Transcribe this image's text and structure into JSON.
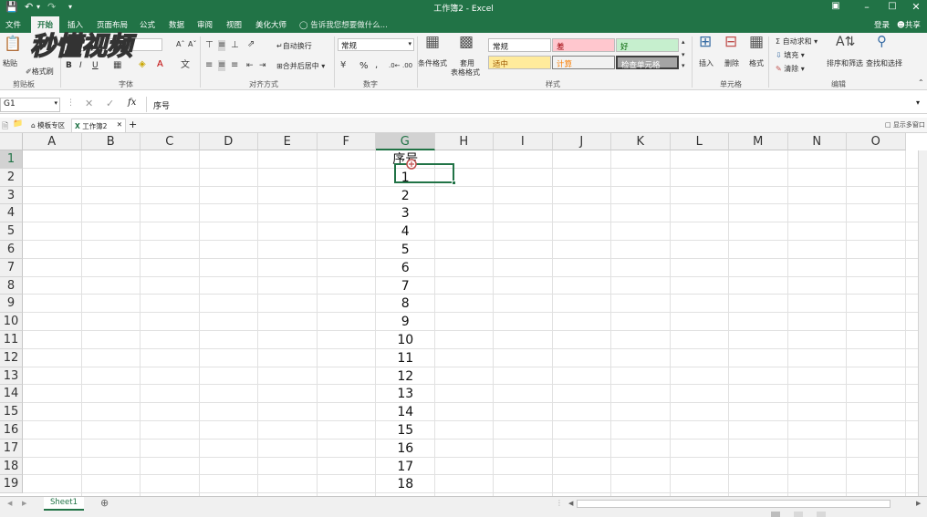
{
  "titlebar": {
    "title": "工作簿2 - Excel",
    "controls": [
      "restore-icon",
      "minimize-icon",
      "maximize-icon",
      "close-icon"
    ]
  },
  "tabs": {
    "file": "文件",
    "home": "开始",
    "insert": "插入",
    "page_layout": "页面布局",
    "formulas": "公式",
    "data": "数据",
    "review": "审阅",
    "view": "视图",
    "beautify": "美化大师",
    "tell_me": "告诉我您想要做什么...",
    "login": "登录",
    "share": "共享"
  },
  "ribbon": {
    "paste": "粘贴",
    "format_painter": "格式刷",
    "clipboard": "剪贴板",
    "bold": "B",
    "italic": "I",
    "underline": "U",
    "font_group": "字体",
    "wrap_text": "自动换行",
    "merge_center": "合并后居中",
    "alignment_group": "对齐方式",
    "number_format": "常规",
    "percent": "%",
    "comma": ",",
    "number_group": "数字",
    "cond_format": "条件格式",
    "table_format_1": "套用",
    "table_format_2": "表格格式",
    "styles": {
      "normal": "常规",
      "bad": "差",
      "good": "好",
      "neutral": "适中",
      "calculation": "计算",
      "check_cell": "检查单元格"
    },
    "styles_group": "样式",
    "insert": "插入",
    "delete": "删除",
    "format": "格式",
    "cells_group": "单元格",
    "autosum": "自动求和",
    "fill": "填充",
    "clear": "清除",
    "sort_filter": "排序和筛选",
    "find_select": "查找和选择",
    "editing_group": "编辑"
  },
  "formula_bar": {
    "name_box": "G1",
    "fx": "fx",
    "content": "序号"
  },
  "workbook_tabs": {
    "template": "模板专区",
    "workbook": "工作簿2",
    "show_multi": "显示多窗口"
  },
  "watermark": "秒懂视频",
  "grid": {
    "columns": [
      "A",
      "B",
      "C",
      "D",
      "E",
      "F",
      "G",
      "H",
      "I",
      "J",
      "K",
      "L",
      "M",
      "N",
      "O"
    ],
    "rows": [
      "1",
      "2",
      "3",
      "4",
      "5",
      "6",
      "7",
      "8",
      "9",
      "10",
      "11",
      "12",
      "13",
      "14",
      "15",
      "16",
      "17",
      "18",
      "19"
    ],
    "col_g_values": [
      "序号",
      "1",
      "2",
      "3",
      "4",
      "5",
      "6",
      "7",
      "8",
      "9",
      "10",
      "11",
      "12",
      "13",
      "14",
      "15",
      "16",
      "17",
      "18"
    ]
  },
  "sheets": {
    "active": "Sheet1"
  },
  "colors": {
    "accent": "#217346",
    "bad_bg": "#ffc7ce",
    "good_bg": "#c6efce",
    "neutral_bg": "#ffeb9c",
    "check_bg": "#a5a5a5"
  }
}
